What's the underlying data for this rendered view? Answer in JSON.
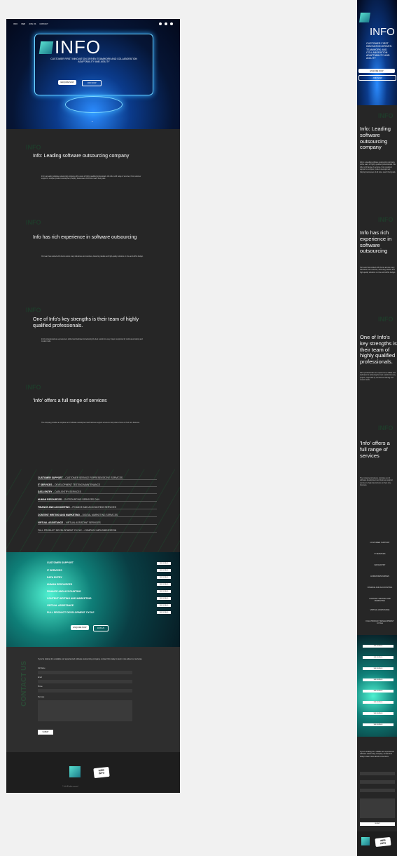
{
  "nav": {
    "items": [
      "INFO",
      "WEB",
      "JOIN US",
      "CONTACT"
    ]
  },
  "hero": {
    "logo": "INFO",
    "tagline": "CUSTOMER FIRST INNOVATION DRIVEN TEAMWORK AND COLLABORATION ADAPTABILITY AND AGILITY",
    "btn_primary": "ENQUIRE NOW",
    "btn_secondary": "JOIN NOW"
  },
  "sections": [
    {
      "ghost": "INFO",
      "title": "Info: Leading software outsourcing company",
      "body": "Info is a leading software outsourcing company with a team of highly qualified professionals. We offer a full range of services, from customer support to complex product development, helping businesses of all sizes reach their goals."
    },
    {
      "ghost": "INFO",
      "title": "Info has rich experience in software outsourcing",
      "body": "Our team has worked with clients across many industries and countries, delivering reliable and high-quality solutions on time and within budget."
    },
    {
      "ghost": "INFO",
      "title": "One of Info's key strengths is their team of highly qualified professionals.",
      "body": "Info's professionals are experienced, skilled and dedicated to delivering the best results for every project, supported by continuous training and modern tools."
    },
    {
      "ghost": "INFO",
      "title": "'Info' offers a full range of services",
      "body": "The company provides a complete set of software development and business support services to help clients focus on their core business."
    }
  ],
  "services": [
    {
      "name": "CUSTOMER SUPPORT",
      "desc": "CUSTOMER SERVICE REPRESENTATIVE SERVICES"
    },
    {
      "name": "IT SERVICES",
      "desc": "DEVELOPMENT TESTING MAINTENANCE"
    },
    {
      "name": "DATA ENTRY",
      "desc": "DATA ENTRY SERVICES"
    },
    {
      "name": "HUMAN RESOURCES",
      "desc": "OUTSOURCING SERVICES CAN"
    },
    {
      "name": "FINANCE AND ACCOUNTING",
      "desc": "FINANCE AND ACCOUNTING SERVICES"
    },
    {
      "name": "CONTENT WRITING AND MARKETING",
      "desc": "DIGITAL MARKETING SERVICES"
    },
    {
      "name": "VIRTUAL ASSISTANCE",
      "desc": "VIRTUAL ASSISTANT SERVICES"
    },
    {
      "name": "FULL PRODUCT DEVELOPMENT CYCLE",
      "desc": "COMPLEX IMPLEMENTATION"
    }
  ],
  "teal": {
    "items": [
      "CUSTOMER SUPPORT",
      "IT SERVICES",
      "DATA ENTRY",
      "HUMAN RESOURCES",
      "FINANCE AND ACCOUNTING",
      "CONTENT WRITING AND MARKETING",
      "VIRTUAL ASSISTANCE",
      "FULL PRODUCT DEVELOPMENT CYCLE"
    ],
    "more_label": "SEE DETAILS",
    "btn_primary": "ENQUIRE NOW",
    "btn_secondary": "JOIN US"
  },
  "form": {
    "ghost": "CONTACT US",
    "intro": "If you're looking for a reliable and experienced software outsourcing company, contact Info today to learn more about our services.",
    "labels": [
      "Full Name",
      "Email",
      "Phone",
      "Message"
    ],
    "submit": "SUBMIT"
  },
  "footer": {
    "badge_top": "WEB",
    "badge_bottom": "INFO",
    "copyright": "© Info. All rights reserved."
  },
  "mobile": {
    "logo": "INFO",
    "tagline": "CUSTOMER FIRST INNOVATION DRIVEN TEAMWORK AND COLLABORATION ADAPTABILITY AND AGILITY",
    "btn_primary": "ENQUIRE NOW",
    "btn_secondary": "JOIN NOW"
  }
}
